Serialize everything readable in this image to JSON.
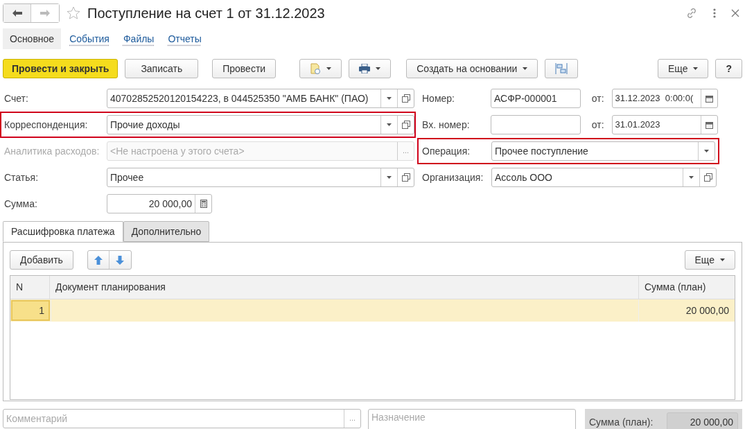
{
  "window": {
    "title": "Поступление на счет 1 от 31.12.2023",
    "favorite": false
  },
  "nav_tabs": [
    {
      "label": "Основное",
      "selected": true
    },
    {
      "label": "События",
      "selected": false
    },
    {
      "label": "Файлы",
      "selected": false
    },
    {
      "label": "Отчеты",
      "selected": false
    }
  ],
  "toolbar": {
    "primary": "Провести и закрыть",
    "buttons": [
      "Записать",
      "Провести"
    ],
    "create_based_on": "Создать на основании",
    "more": "Еще",
    "help": "?"
  },
  "left_fields": [
    {
      "label": "Счет:",
      "value": "40702852520120154223, в 044525350 \"АМБ БАНК\" (ПАО)",
      "kind": "select",
      "buttons": [
        {
          "kind": "dropdown"
        },
        {
          "kind": "open"
        }
      ],
      "highlighted": false,
      "disabled": false
    },
    {
      "label": "Корреспонденция:",
      "value": "Прочие доходы",
      "kind": "select",
      "buttons": [
        {
          "kind": "dropdown"
        },
        {
          "kind": "open"
        }
      ],
      "highlighted": true,
      "disabled": false
    },
    {
      "label": "Аналитика расходов:",
      "placeholder": "<Не настроена у этого счета>",
      "kind": "select",
      "buttons": [
        {
          "kind": "ellipsis",
          "text": "..."
        }
      ],
      "highlighted": false,
      "disabled": true
    },
    {
      "label": "Статья:",
      "value": "Прочее",
      "kind": "select",
      "buttons": [
        {
          "kind": "dropdown"
        },
        {
          "kind": "open"
        }
      ],
      "highlighted": false,
      "disabled": false
    },
    {
      "label": "Сумма:",
      "value": "20 000,00",
      "kind": "number",
      "buttons": [
        {
          "kind": "calculator"
        }
      ],
      "highlighted": false,
      "disabled": false
    }
  ],
  "right_fields": [
    {
      "label": "Номер:",
      "value": "АСФР-000001",
      "kind": "number_date",
      "date_label": "от:",
      "date": "31.12.2023  0:00:0(",
      "highlighted": false
    },
    {
      "label": "Вх. номер:",
      "kind": "number_date",
      "date_label": "от:",
      "date": "31.01.2023",
      "highlighted": false
    },
    {
      "label": "Операция:",
      "value": "Прочее поступление",
      "kind": "select",
      "buttons": [
        {
          "kind": "dropdown"
        }
      ],
      "highlighted": true
    },
    {
      "label": "Организация:",
      "value": "Ассоль ООО",
      "kind": "select",
      "buttons": [
        {
          "kind": "dropdown"
        },
        {
          "kind": "open"
        }
      ],
      "highlighted": false
    }
  ],
  "section_tabs": [
    {
      "label": "Расшифровка платежа",
      "selected": true
    },
    {
      "label": "Дополнительно",
      "selected": false
    }
  ],
  "table_toolbar": {
    "add": "Добавить",
    "more": "Еще"
  },
  "table": {
    "columns": [
      "N",
      "Документ планирования",
      "Сумма (план)"
    ],
    "rows": [
      {
        "n": "1",
        "amount": "20 000,00",
        "selected": true
      }
    ]
  },
  "footer": {
    "comment_placeholder": "Комментарий",
    "comment_button": "...",
    "purpose_placeholder": "Назначение",
    "total_label": "Сумма (план):",
    "total_value": "20 000,00"
  }
}
